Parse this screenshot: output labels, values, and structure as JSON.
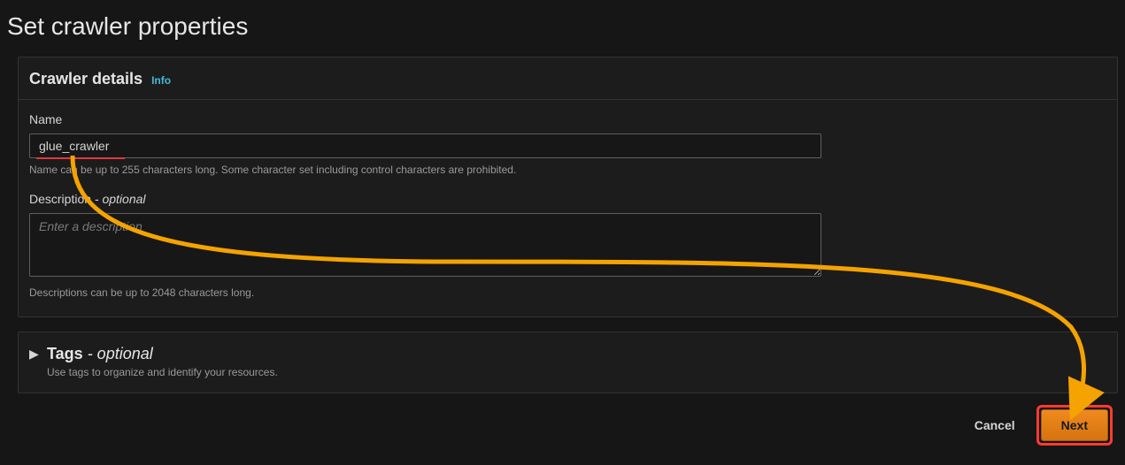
{
  "page": {
    "title": "Set crawler properties"
  },
  "details": {
    "header": "Crawler details",
    "info_label": "Info",
    "name": {
      "label": "Name",
      "value": "glue_crawler",
      "hint": "Name can be up to 255 characters long. Some character set including control characters are prohibited."
    },
    "description": {
      "label": "Description",
      "optional_suffix": " - optional",
      "placeholder": "Enter a description",
      "value": "",
      "hint": "Descriptions can be up to 2048 characters long."
    }
  },
  "tags": {
    "title": "Tags",
    "optional_suffix": " - optional",
    "desc": "Use tags to organize and identify your resources."
  },
  "footer": {
    "cancel": "Cancel",
    "next": "Next"
  }
}
